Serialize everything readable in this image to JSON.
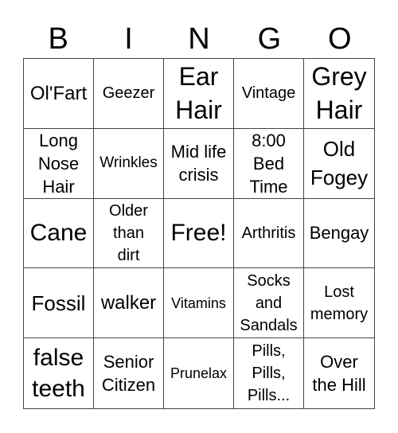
{
  "header": {
    "letters": [
      "B",
      "I",
      "N",
      "G",
      "O"
    ]
  },
  "cells": [
    "Ol'Fart",
    "Geezer",
    "Ear\nHair",
    "Vintage",
    "Grey\nHair",
    "Long\nNose\nHair",
    "Wrinkles",
    "Mid life\ncrisis",
    "8:00\nBed\nTime",
    "Old\nFogey",
    "Cane",
    "Older\nthan\ndirt",
    "Free!",
    "Arthritis",
    "Bengay",
    "Fossil",
    "walker",
    "Vitamins",
    "Socks\nand\nSandals",
    "Lost\nmemory",
    "false\nteeth",
    "Senior\nCitizen",
    "Prunelax",
    "Pills,\nPills,\nPills...",
    "Over\nthe Hill"
  ]
}
